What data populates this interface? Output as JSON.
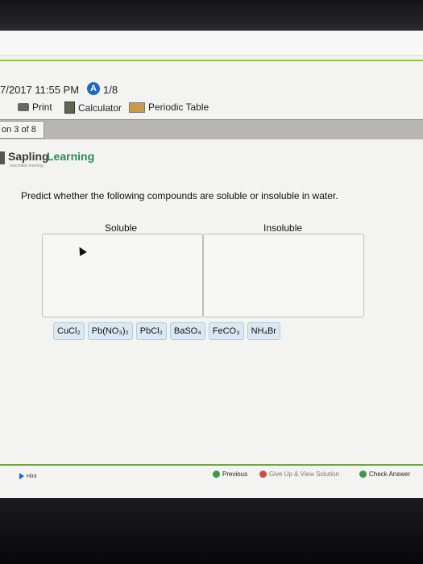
{
  "header": {
    "datetime": "7/2017 11:55 PM",
    "badge_letter": "A",
    "page_count": "1/8"
  },
  "toolbar": {
    "print_label": "Print",
    "calculator_label": "Calculator",
    "periodic_table_label": "Periodic Table"
  },
  "question_tab": {
    "label": "on 3 of 8"
  },
  "brand": {
    "name_part1": "Sapling",
    "name_part2": "Learning",
    "tagline": "macmillan learning"
  },
  "question": {
    "prompt": "Predict whether the following compounds are soluble or insoluble in water.",
    "columns": [
      {
        "label": "Soluble"
      },
      {
        "label": "Insoluble"
      }
    ],
    "compounds": [
      "CuCl₂",
      "Pb(NO₃)₂",
      "PbCl₂",
      "BaSO₄",
      "FeCO₃",
      "NH₄Br"
    ]
  },
  "footer": {
    "hint_label": "Hint",
    "previous_label": "Previous",
    "give_up_label": "Give Up & View Solution",
    "check_answer_label": "Check Answer"
  },
  "colors": {
    "accent": "#8cc43f",
    "brand_green": "#2c8a5a",
    "badge_blue": "#1f66c8"
  }
}
